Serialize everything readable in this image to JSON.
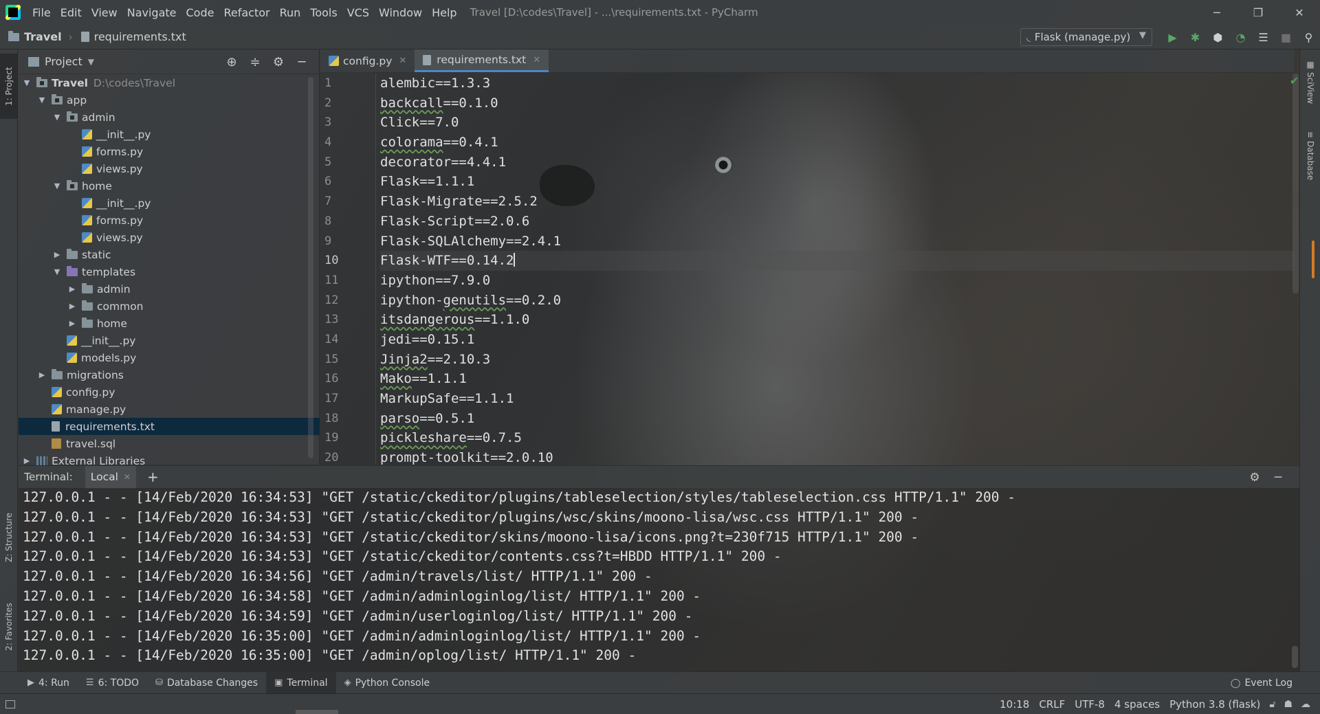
{
  "app": {
    "menu": [
      "File",
      "Edit",
      "View",
      "Navigate",
      "Code",
      "Refactor",
      "Run",
      "Tools",
      "VCS",
      "Window",
      "Help"
    ],
    "window_title": "Travel [D:\\codes\\Travel] - ...\\requirements.txt - PyCharm",
    "win_controls": [
      "─",
      "❐",
      "✕"
    ]
  },
  "nav": {
    "project": "Travel",
    "file": "requirements.txt",
    "run_config": "Flask (manage.py)"
  },
  "left_tabs": {
    "project": "1: Project",
    "structure": "Z: Structure",
    "favorites": "2: Favorites"
  },
  "right_tabs": {
    "sciview": "SciView",
    "database": "Database"
  },
  "project_panel": {
    "title": "Project",
    "tree": [
      {
        "label": "Travel",
        "path": "D:\\codes\\Travel",
        "depth": 0,
        "icon": "module-folder-icon",
        "arrow": "open",
        "bold": true
      },
      {
        "label": "app",
        "depth": 1,
        "icon": "package-folder-icon",
        "arrow": "open"
      },
      {
        "label": "admin",
        "depth": 2,
        "icon": "package-folder-icon",
        "arrow": "open"
      },
      {
        "label": "__init__.py",
        "depth": 3,
        "icon": "python-file-icon",
        "arrow": "none"
      },
      {
        "label": "forms.py",
        "depth": 3,
        "icon": "python-file-icon",
        "arrow": "none"
      },
      {
        "label": "views.py",
        "depth": 3,
        "icon": "python-file-icon",
        "arrow": "none"
      },
      {
        "label": "home",
        "depth": 2,
        "icon": "package-folder-icon",
        "arrow": "open"
      },
      {
        "label": "__init__.py",
        "depth": 3,
        "icon": "python-file-icon",
        "arrow": "none"
      },
      {
        "label": "forms.py",
        "depth": 3,
        "icon": "python-file-icon",
        "arrow": "none"
      },
      {
        "label": "views.py",
        "depth": 3,
        "icon": "python-file-icon",
        "arrow": "none"
      },
      {
        "label": "static",
        "depth": 2,
        "icon": "folder-icon",
        "arrow": "closed"
      },
      {
        "label": "templates",
        "depth": 2,
        "icon": "templates-folder-icon",
        "arrow": "open"
      },
      {
        "label": "admin",
        "depth": 3,
        "icon": "folder-icon",
        "arrow": "closed"
      },
      {
        "label": "common",
        "depth": 3,
        "icon": "folder-icon",
        "arrow": "closed"
      },
      {
        "label": "home",
        "depth": 3,
        "icon": "folder-icon",
        "arrow": "closed"
      },
      {
        "label": "__init__.py",
        "depth": 2,
        "icon": "python-file-icon",
        "arrow": "none"
      },
      {
        "label": "models.py",
        "depth": 2,
        "icon": "python-file-icon",
        "arrow": "none"
      },
      {
        "label": "migrations",
        "depth": 1,
        "icon": "folder-icon",
        "arrow": "closed"
      },
      {
        "label": "config.py",
        "depth": 1,
        "icon": "python-file-icon",
        "arrow": "none"
      },
      {
        "label": "manage.py",
        "depth": 1,
        "icon": "python-file-icon",
        "arrow": "none"
      },
      {
        "label": "requirements.txt",
        "depth": 1,
        "icon": "text-file-icon",
        "arrow": "none",
        "selected": true
      },
      {
        "label": "travel.sql",
        "depth": 1,
        "icon": "sql-file-icon",
        "arrow": "none"
      },
      {
        "label": "External Libraries",
        "depth": 0,
        "icon": "libraries-icon",
        "arrow": "closed"
      }
    ]
  },
  "editor": {
    "tabs": [
      {
        "label": "config.py",
        "icon": "python-file-icon",
        "active": false
      },
      {
        "label": "requirements.txt",
        "icon": "text-file-icon",
        "active": true
      }
    ],
    "current_line": 10,
    "lines": [
      {
        "n": "1",
        "pre": "",
        "sq": "",
        "post": "alembic==1.3.3"
      },
      {
        "n": "2",
        "pre": "",
        "sq": "backcall",
        "post": "==0.1.0"
      },
      {
        "n": "3",
        "pre": "",
        "sq": "",
        "post": "Click==7.0"
      },
      {
        "n": "4",
        "pre": "",
        "sq": "colorama",
        "post": "==0.4.1"
      },
      {
        "n": "5",
        "pre": "",
        "sq": "",
        "post": "decorator==4.4.1"
      },
      {
        "n": "6",
        "pre": "",
        "sq": "",
        "post": "Flask==1.1.1"
      },
      {
        "n": "7",
        "pre": "",
        "sq": "",
        "post": "Flask-Migrate==2.5.2"
      },
      {
        "n": "8",
        "pre": "",
        "sq": "",
        "post": "Flask-Script==2.0.6"
      },
      {
        "n": "9",
        "pre": "",
        "sq": "",
        "post": "Flask-SQLAlchemy==2.4.1"
      },
      {
        "n": "10",
        "pre": "",
        "sq": "",
        "post": "Flask-WTF==0.14.2"
      },
      {
        "n": "11",
        "pre": "",
        "sq": "",
        "post": "ipython==7.9.0"
      },
      {
        "n": "12",
        "pre": "ipython-",
        "sq": "genutils",
        "post": "==0.2.0"
      },
      {
        "n": "13",
        "pre": "",
        "sq": "itsdangerous",
        "post": "==1.1.0"
      },
      {
        "n": "14",
        "pre": "",
        "sq": "",
        "post": "jedi==0.15.1"
      },
      {
        "n": "15",
        "pre": "",
        "sq": "Jinja2",
        "post": "==2.10.3"
      },
      {
        "n": "16",
        "pre": "",
        "sq": "Mako",
        "post": "==1.1.1"
      },
      {
        "n": "17",
        "pre": "",
        "sq": "",
        "post": "MarkupSafe==1.1.1"
      },
      {
        "n": "18",
        "pre": "",
        "sq": "parso",
        "post": "==0.5.1"
      },
      {
        "n": "19",
        "pre": "",
        "sq": "pickleshare",
        "post": "==0.7.5"
      },
      {
        "n": "20",
        "pre": "",
        "sq": "",
        "post": "prompt-toolkit==2.0.10"
      }
    ]
  },
  "terminal": {
    "label": "Terminal:",
    "tab": "Local",
    "lines": [
      "127.0.0.1 - - [14/Feb/2020 16:34:53] \"GET /static/ckeditor/plugins/tableselection/styles/tableselection.css HTTP/1.1\" 200 -",
      "127.0.0.1 - - [14/Feb/2020 16:34:53] \"GET /static/ckeditor/plugins/wsc/skins/moono-lisa/wsc.css HTTP/1.1\" 200 -",
      "127.0.0.1 - - [14/Feb/2020 16:34:53] \"GET /static/ckeditor/skins/moono-lisa/icons.png?t=230f715 HTTP/1.1\" 200 -",
      "127.0.0.1 - - [14/Feb/2020 16:34:53] \"GET /static/ckeditor/contents.css?t=HBDD HTTP/1.1\" 200 -",
      "127.0.0.1 - - [14/Feb/2020 16:34:56] \"GET /admin/travels/list/ HTTP/1.1\" 200 -",
      "127.0.0.1 - - [14/Feb/2020 16:34:58] \"GET /admin/adminloginlog/list/ HTTP/1.1\" 200 -",
      "127.0.0.1 - - [14/Feb/2020 16:34:59] \"GET /admin/userloginlog/list/ HTTP/1.1\" 200 -",
      "127.0.0.1 - - [14/Feb/2020 16:35:00] \"GET /admin/adminloginlog/list/ HTTP/1.1\" 200 -",
      "127.0.0.1 - - [14/Feb/2020 16:35:00] \"GET /admin/oplog/list/ HTTP/1.1\" 200 -"
    ]
  },
  "toolwindows": {
    "run": "4: Run",
    "todo": "6: TODO",
    "db_changes": "Database Changes",
    "terminal": "Terminal",
    "python_console": "Python Console",
    "event_log": "Event Log"
  },
  "status": {
    "position": "10:18",
    "line_sep": "CRLF",
    "encoding": "UTF-8",
    "indent": "4 spaces",
    "interpreter": "Python 3.8 (flask)"
  }
}
